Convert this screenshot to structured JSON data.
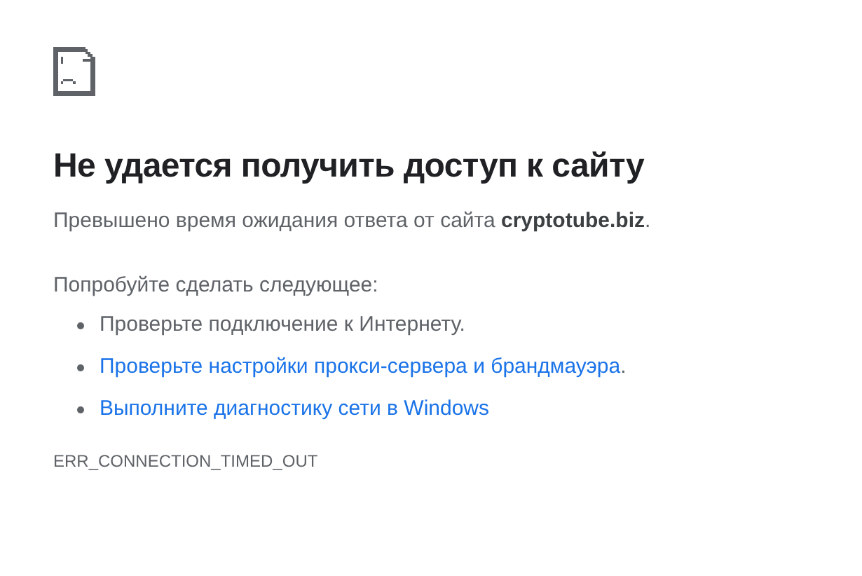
{
  "heading": "Не удается получить доступ к сайту",
  "message": "Превышено время ожидания ответа от сайта **cryptotube.biz**.",
  "suggestions_label": "Попробуйте сделать следующее:",
  "suggestions": [
    {
      "kind": "text",
      "text": "Проверьте подключение к Интернету."
    },
    {
      "kind": "link",
      "text": "Проверьте настройки прокси-сервера и брандмауэра",
      "suffix": "."
    },
    {
      "kind": "link",
      "text": "Выполните диагностику сети в Windows"
    }
  ],
  "error_code": "ERR_CONNECTION_TIMED_OUT"
}
